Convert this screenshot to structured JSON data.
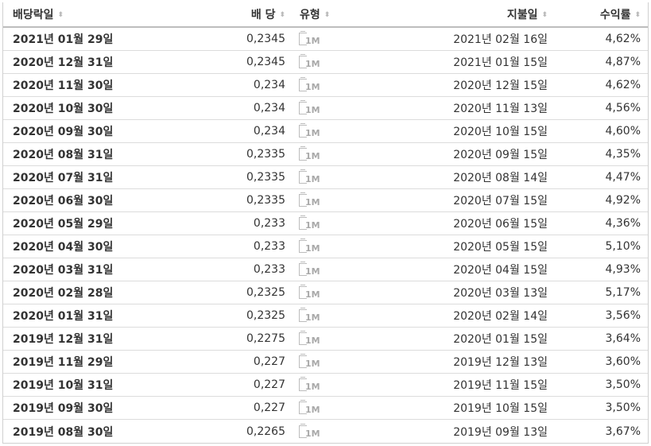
{
  "headers": {
    "ex_date": "배당락일",
    "dividend": "배 당",
    "type": "유형",
    "pay_date": "지불일",
    "yield": "수익률",
    "sort_glyph": "⬍"
  },
  "type_icon_label": "1M",
  "rows": [
    {
      "ex_date": "2021년 01월 29일",
      "dividend": "0,2345",
      "pay_date": "2021년 02월 16일",
      "yield": "4,62%"
    },
    {
      "ex_date": "2020년 12월 31일",
      "dividend": "0,2345",
      "pay_date": "2021년 01월 15일",
      "yield": "4,87%"
    },
    {
      "ex_date": "2020년 11월 30일",
      "dividend": "0,234",
      "pay_date": "2020년 12월 15일",
      "yield": "4,62%"
    },
    {
      "ex_date": "2020년 10월 30일",
      "dividend": "0,234",
      "pay_date": "2020년 11월 13일",
      "yield": "4,56%"
    },
    {
      "ex_date": "2020년 09월 30일",
      "dividend": "0,234",
      "pay_date": "2020년 10월 15일",
      "yield": "4,60%"
    },
    {
      "ex_date": "2020년 08월 31일",
      "dividend": "0,2335",
      "pay_date": "2020년 09월 15일",
      "yield": "4,35%"
    },
    {
      "ex_date": "2020년 07월 31일",
      "dividend": "0,2335",
      "pay_date": "2020년 08월 14일",
      "yield": "4,47%"
    },
    {
      "ex_date": "2020년 06월 30일",
      "dividend": "0,2335",
      "pay_date": "2020년 07월 15일",
      "yield": "4,92%"
    },
    {
      "ex_date": "2020년 05월 29일",
      "dividend": "0,233",
      "pay_date": "2020년 06월 15일",
      "yield": "4,36%"
    },
    {
      "ex_date": "2020년 04월 30일",
      "dividend": "0,233",
      "pay_date": "2020년 05월 15일",
      "yield": "5,10%"
    },
    {
      "ex_date": "2020년 03월 31일",
      "dividend": "0,233",
      "pay_date": "2020년 04월 15일",
      "yield": "4,93%"
    },
    {
      "ex_date": "2020년 02월 28일",
      "dividend": "0,2325",
      "pay_date": "2020년 03월 13일",
      "yield": "5,17%"
    },
    {
      "ex_date": "2020년 01월 31일",
      "dividend": "0,2325",
      "pay_date": "2020년 02월 14일",
      "yield": "3,56%"
    },
    {
      "ex_date": "2019년 12월 31일",
      "dividend": "0,2275",
      "pay_date": "2020년 01월 15일",
      "yield": "3,64%"
    },
    {
      "ex_date": "2019년 11월 29일",
      "dividend": "0,227",
      "pay_date": "2019년 12월 13일",
      "yield": "3,60%"
    },
    {
      "ex_date": "2019년 10월 31일",
      "dividend": "0,227",
      "pay_date": "2019년 11월 15일",
      "yield": "3,50%"
    },
    {
      "ex_date": "2019년 09월 30일",
      "dividend": "0,227",
      "pay_date": "2019년 10월 15일",
      "yield": "3,50%"
    },
    {
      "ex_date": "2019년 08월 30일",
      "dividend": "0,2265",
      "pay_date": "2019년 09월 13일",
      "yield": "3,67%"
    }
  ]
}
